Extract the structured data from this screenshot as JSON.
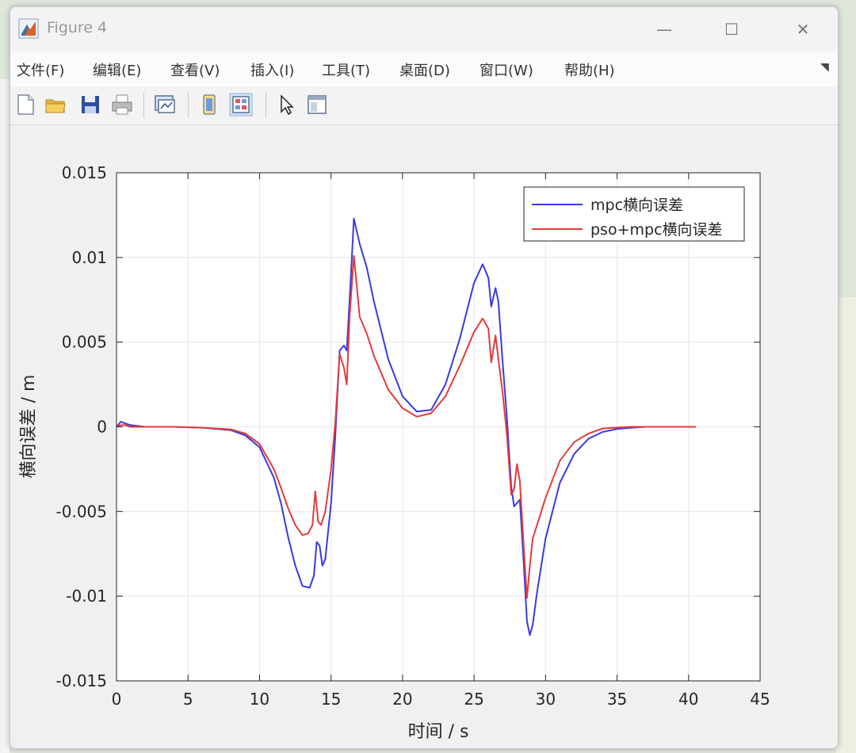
{
  "window": {
    "title": "Figure 4",
    "controls": {
      "minimize": "—",
      "maximize": "☐",
      "close": "✕"
    }
  },
  "menu": [
    "文件(F)",
    "编辑(E)",
    "查看(V)",
    "插入(I)",
    "工具(T)",
    "桌面(D)",
    "窗口(W)",
    "帮助(H)"
  ],
  "toolbar_icons": [
    "new-figure-icon",
    "open-file-icon",
    "save-icon",
    "print-icon",
    "link-plot-icon",
    "hide-plot-tools-icon",
    "show-plot-tools-icon",
    "edit-plot-icon",
    "open-property-inspector-icon"
  ],
  "colors": {
    "mpc": "#3a3ae0",
    "pso": "#e43a3a"
  },
  "chart_data": {
    "type": "line",
    "xlabel": "时间 / s",
    "ylabel": "横向误差 / m",
    "xlim": [
      0,
      45
    ],
    "ylim": [
      -0.015,
      0.015
    ],
    "xticks": [
      0,
      5,
      10,
      15,
      20,
      25,
      30,
      35,
      40,
      45
    ],
    "xtick_labels": [
      "0",
      "5",
      "10",
      "15",
      "20",
      "25",
      "30",
      "35",
      "40",
      "45"
    ],
    "yticks": [
      -0.015,
      -0.01,
      -0.005,
      0,
      0.005,
      0.01,
      0.015
    ],
    "ytick_labels": [
      "-0.015",
      "-0.01",
      "-0.005",
      "0",
      "0.005",
      "0.01",
      "0.015"
    ],
    "grid": true,
    "legend_position": "top-right",
    "series": [
      {
        "name": "mpc横向误差",
        "color": "#3a3ae0",
        "x": [
          0,
          0.3,
          0.6,
          1,
          2,
          4,
          6,
          8,
          9,
          10,
          11,
          11.5,
          12,
          12.5,
          13,
          13.5,
          13.8,
          14,
          14.2,
          14.4,
          14.6,
          15,
          15.3,
          15.6,
          15.9,
          16.1,
          16.3,
          16.6,
          17,
          17.5,
          18,
          19,
          20,
          21,
          22,
          23,
          24,
          25,
          25.6,
          26,
          26.2,
          26.5,
          26.7,
          27,
          27.3,
          27.6,
          27.8,
          28,
          28.2,
          28.5,
          28.7,
          28.9,
          29.1,
          29.4,
          30,
          31,
          32,
          33,
          34,
          35,
          36,
          37,
          38,
          39,
          40,
          40.5
        ],
        "y": [
          0,
          0.0003,
          0.0002,
          0.0001,
          0,
          0,
          -5e-05,
          -0.0002,
          -0.0005,
          -0.0012,
          -0.003,
          -0.0045,
          -0.0065,
          -0.0082,
          -0.0094,
          -0.0095,
          -0.0088,
          -0.0068,
          -0.007,
          -0.0082,
          -0.0078,
          -0.0045,
          -0.0005,
          0.0045,
          0.0048,
          0.0045,
          0.0075,
          0.0123,
          0.0108,
          0.0094,
          0.0074,
          0.004,
          0.0018,
          0.0009,
          0.001,
          0.0025,
          0.0052,
          0.0085,
          0.0096,
          0.0088,
          0.0071,
          0.0082,
          0.0074,
          0.0038,
          0.0005,
          -0.0035,
          -0.0047,
          -0.0045,
          -0.0043,
          -0.0085,
          -0.0115,
          -0.0123,
          -0.0117,
          -0.0098,
          -0.0066,
          -0.0033,
          -0.0016,
          -0.0007,
          -0.0003,
          -0.00012,
          -5e-05,
          0,
          0,
          0,
          0,
          0
        ]
      },
      {
        "name": "pso+mpc横向误差",
        "color": "#e43a3a",
        "x": [
          0,
          0.3,
          0.6,
          1,
          2,
          4,
          6,
          8,
          9,
          10,
          11,
          11.5,
          12,
          12.5,
          13,
          13.4,
          13.7,
          13.9,
          14.1,
          14.3,
          14.6,
          15,
          15.3,
          15.6,
          15.9,
          16.1,
          16.3,
          16.6,
          17,
          17.5,
          18,
          19,
          20,
          21,
          22,
          23,
          24,
          25,
          25.6,
          26,
          26.2,
          26.5,
          26.7,
          27,
          27.3,
          27.6,
          27.8,
          28,
          28.2,
          28.5,
          28.7,
          28.9,
          29.1,
          29.4,
          30,
          31,
          32,
          33,
          34,
          35,
          36,
          37,
          38,
          39,
          40,
          40.5
        ],
        "y": [
          0,
          0.0001,
          0.0001,
          0,
          0,
          0,
          -5e-05,
          -0.00015,
          -0.0004,
          -0.001,
          -0.0025,
          -0.0036,
          -0.0048,
          -0.0058,
          -0.0064,
          -0.0063,
          -0.0058,
          -0.0038,
          -0.0056,
          -0.0058,
          -0.005,
          -0.0025,
          0.0003,
          0.0043,
          0.0035,
          0.0025,
          0.0065,
          0.0101,
          0.0065,
          0.0055,
          0.0042,
          0.0022,
          0.0011,
          0.0006,
          0.0008,
          0.0018,
          0.0036,
          0.0056,
          0.0064,
          0.0058,
          0.0038,
          0.0054,
          0.004,
          0.002,
          -0.0005,
          -0.004,
          -0.0037,
          -0.0022,
          -0.0032,
          -0.0075,
          -0.0101,
          -0.0082,
          -0.0066,
          -0.0058,
          -0.0042,
          -0.002,
          -0.0009,
          -0.0004,
          -0.0001,
          -4e-05,
          0,
          0,
          0,
          0,
          0,
          0
        ]
      }
    ]
  }
}
